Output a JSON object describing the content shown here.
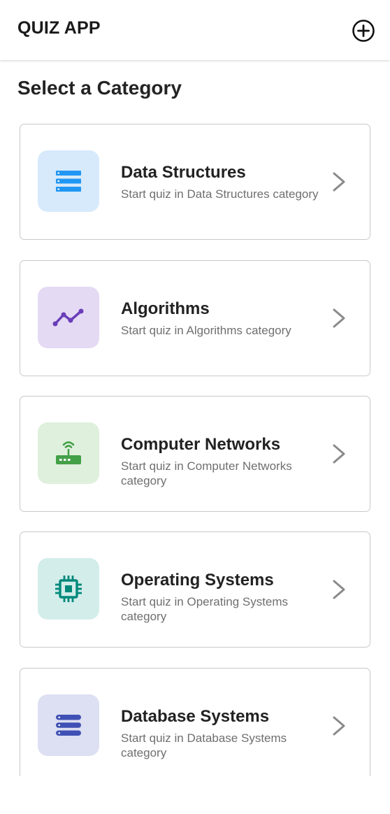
{
  "app_bar": {
    "title": "QUIZ APP",
    "add_icon": "add-circle-icon"
  },
  "page": {
    "heading": "Select a Category"
  },
  "categories": [
    {
      "title": "Data Structures",
      "subtitle": "Start quiz in Data Structures category",
      "icon": "list-stack-icon",
      "icon_color": "#2196F3",
      "icon_bg": "#D6EAFB"
    },
    {
      "title": "Algorithms",
      "subtitle": "Start quiz in Algorithms category",
      "icon": "trend-line-icon",
      "icon_color": "#6A3DB8",
      "icon_bg": "#E4DAF4"
    },
    {
      "title": "Computer Networks",
      "subtitle": "Start quiz in Computer Networks category",
      "icon": "router-icon",
      "icon_color": "#43A047",
      "icon_bg": "#DFF0DD"
    },
    {
      "title": "Operating Systems",
      "subtitle": "Start quiz in Operating Systems category",
      "icon": "chip-icon",
      "icon_color": "#00897B",
      "icon_bg": "#D3EDEA"
    },
    {
      "title": "Database Systems",
      "subtitle": "Start quiz in Database Systems category",
      "icon": "storage-icon",
      "icon_color": "#3F51B5",
      "icon_bg": "#DDDFF2"
    }
  ]
}
